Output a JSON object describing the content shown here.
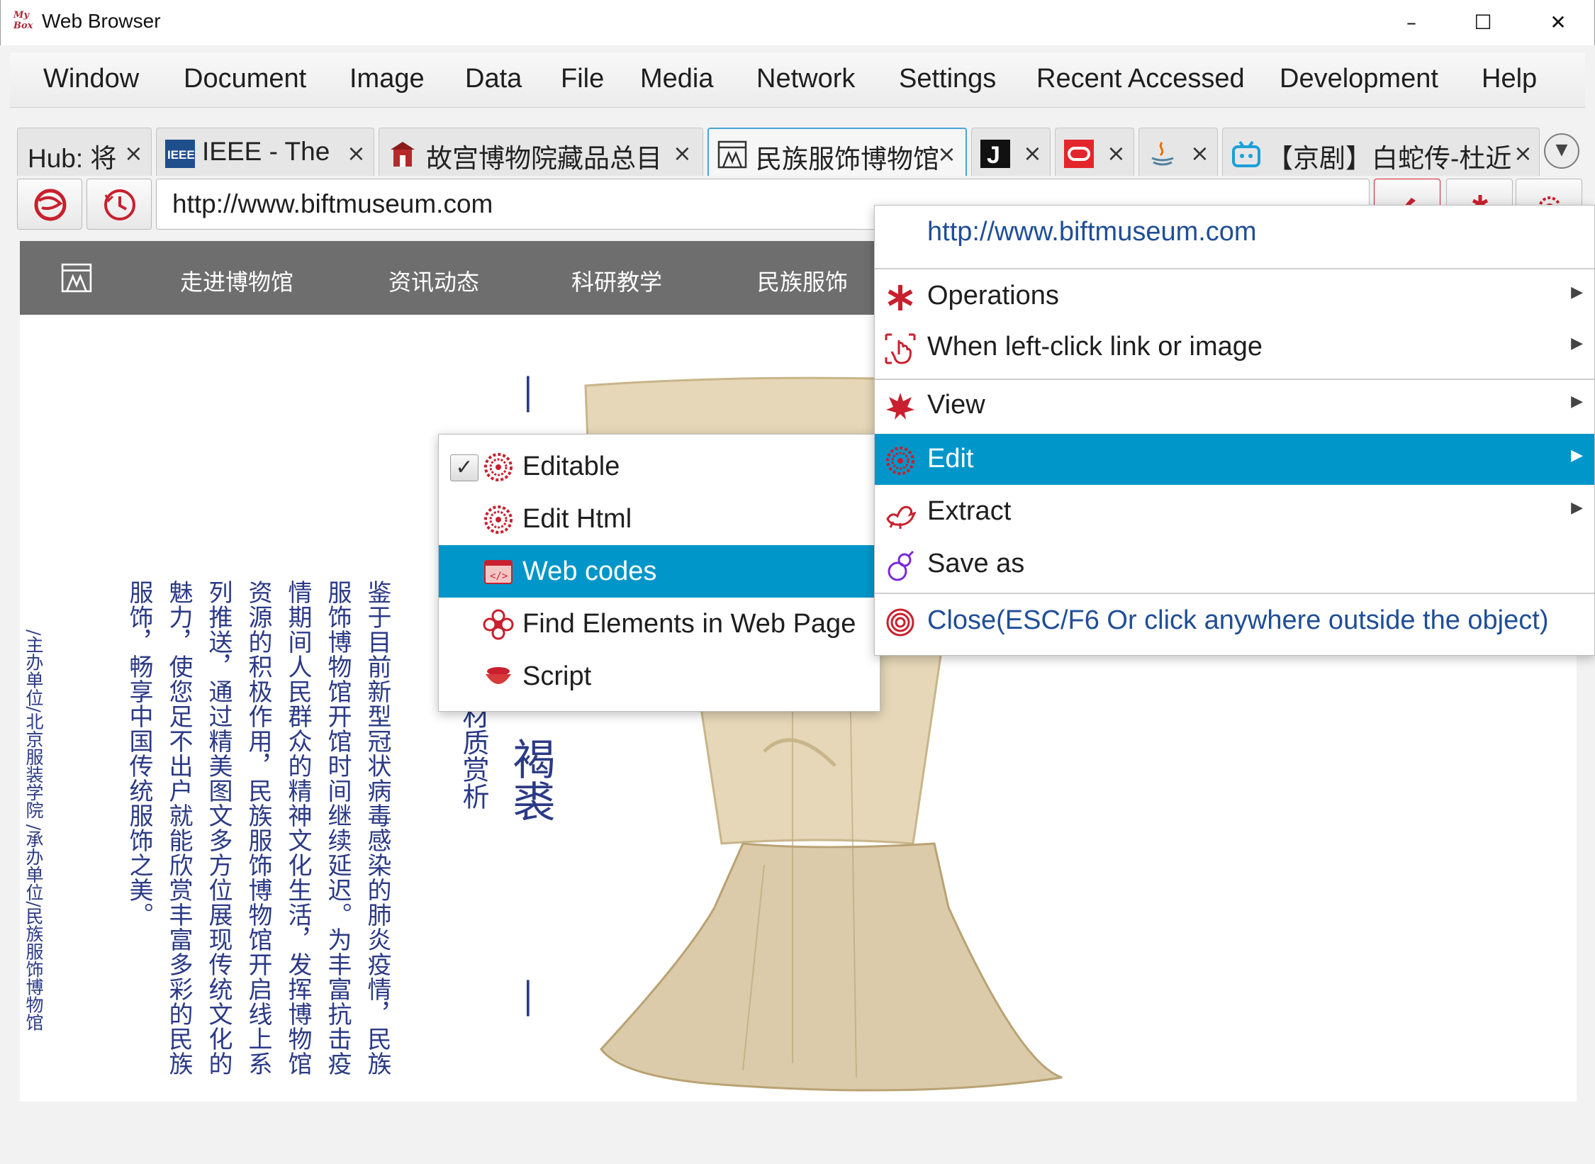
{
  "window": {
    "logo_text": "My Box",
    "title": "Web Browser",
    "minimize": "–",
    "maximize": "☐",
    "close": "✕"
  },
  "menubar": [
    "Window",
    "Document",
    "Image",
    "Data",
    "File",
    "Media",
    "Network",
    "Settings",
    "Recent Accessed",
    "Development",
    "Help"
  ],
  "tabs": [
    {
      "label": "Hub: 将",
      "icon": "hub-icon",
      "active": false
    },
    {
      "label": "IEEE - The",
      "icon": "ieee-icon",
      "active": false
    },
    {
      "label": "故宫博物院藏品总目",
      "icon": "palace-museum-icon",
      "active": false
    },
    {
      "label": "民族服饰博物馆",
      "icon": "museum-logo-icon",
      "active": true
    },
    {
      "label": "",
      "icon": "j-logo-icon",
      "active": false
    },
    {
      "label": "",
      "icon": "oracle-icon",
      "active": false
    },
    {
      "label": "",
      "icon": "java-icon",
      "active": false
    },
    {
      "label": "【京剧】白蛇传-杜近",
      "icon": "bilibili-icon",
      "active": false
    }
  ],
  "tab_close_glyph": "×",
  "address": {
    "url": "http://www.biftmuseum.com"
  },
  "site": {
    "nav": [
      "走进博物馆",
      "资讯动态",
      "科研教学",
      "民族服饰"
    ],
    "columns": [
      "鉴于目前新型冠状病毒感染的肺炎疫情，民族",
      "服饰博物馆开馆时间继续延迟。为丰富抗击疫",
      "情期间人民群众的精神文化生活，发挥博物馆",
      "资源的积极作用，民族服饰博物馆开启线上系",
      "列推送，通过精美图文多方位展现传统文化的",
      "魅力，使您足不出户就能欣赏丰富多彩的民族",
      "服饰，畅享中国传统服饰之美。"
    ],
    "credits": "/主办单位/北京服装学院 /承办单位/民族服饰博物馆",
    "heading_dash": "—",
    "heading_main": "褐裘",
    "heading_sub": "材质赏析"
  },
  "context_menu": {
    "url": "http://www.biftmuseum.com",
    "items": [
      {
        "label": "Operations",
        "icon": "asterisk-icon",
        "submenu": true
      },
      {
        "label": "When left-click link or image",
        "icon": "click-hand-icon",
        "submenu": true
      },
      {
        "label": "View",
        "icon": "maple-leaf-icon",
        "submenu": true
      },
      {
        "label": "Edit",
        "icon": "chrysanthemum-icon",
        "submenu": true,
        "selected": true
      },
      {
        "label": "Extract",
        "icon": "dragon-icon",
        "submenu": true
      },
      {
        "label": "Save as",
        "icon": "gourd-icon",
        "submenu": false
      },
      {
        "label": "Close(ESC/F6 Or click anywhere outside the object)",
        "icon": "close-swirl-icon",
        "submenu": false
      }
    ],
    "arrow": "▶"
  },
  "edit_submenu": {
    "check": "✓",
    "items": [
      {
        "label": "Editable",
        "icon": "chrysanthemum-icon",
        "checked": true
      },
      {
        "label": "Edit Html",
        "icon": "chrysanthemum-icon"
      },
      {
        "label": "Web codes",
        "icon": "code-window-icon",
        "selected": true
      },
      {
        "label": "Find Elements in Web Page",
        "icon": "find-knot-icon"
      },
      {
        "label": "Script",
        "icon": "script-bowl-icon"
      }
    ]
  },
  "colors": {
    "selection": "#0096c9",
    "accent_red": "#c8202e",
    "menu_link": "#1f4e96",
    "site_nav_bg": "#6e6e6e",
    "vertical_text": "#2b3a86"
  }
}
